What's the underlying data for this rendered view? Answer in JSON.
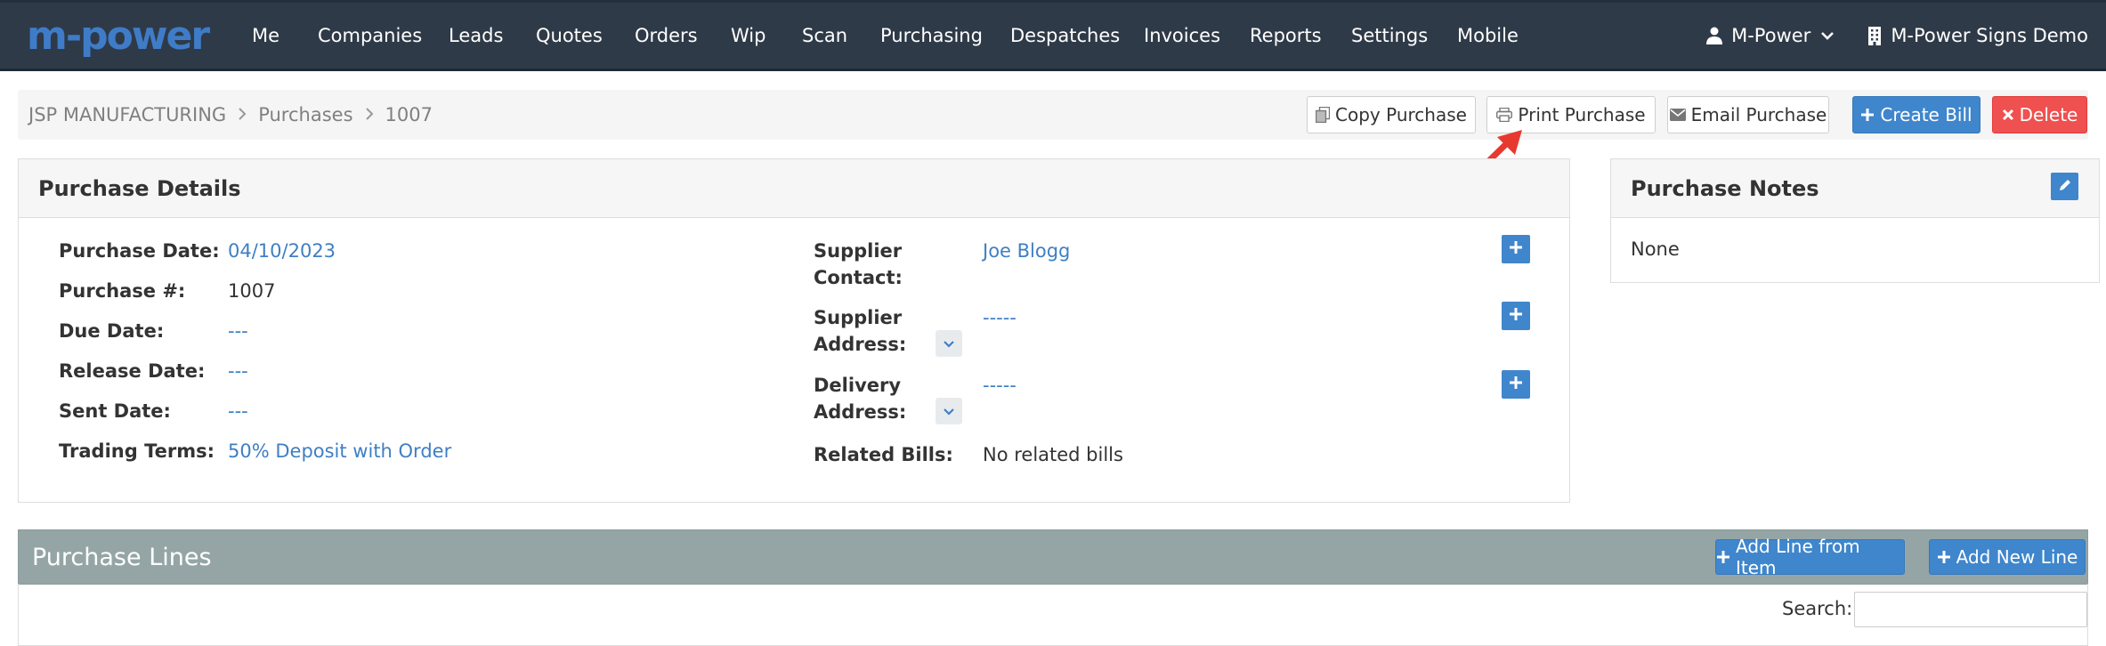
{
  "nav": {
    "logo": "m-power",
    "items": [
      "Me",
      "Companies",
      "Leads",
      "Quotes",
      "Orders",
      "Wip",
      "Scan",
      "Purchasing",
      "Despatches",
      "Invoices",
      "Reports",
      "Settings",
      "Mobile"
    ],
    "user": "M-Power",
    "company": "M-Power Signs Demo"
  },
  "breadcrumb": {
    "items": [
      "JSP MANUFACTURING",
      "Purchases",
      "1007"
    ]
  },
  "toolbar": {
    "copy": "Copy Purchase",
    "print": "Print Purchase",
    "email": "Email Purchase",
    "create_bill": "Create Bill",
    "delete": "Delete"
  },
  "details": {
    "title": "Purchase Details",
    "purchase_date_label": "Purchase Date:",
    "purchase_date": "04/10/2023",
    "purchase_no_label": "Purchase #:",
    "purchase_no": "1007",
    "due_date_label": "Due Date:",
    "due_date": "---",
    "release_date_label": "Release Date:",
    "release_date": "---",
    "sent_date_label": "Sent Date:",
    "sent_date": "---",
    "trading_terms_label": "Trading Terms:",
    "trading_terms": "50% Deposit with Order",
    "supplier_contact_label_1": "Supplier",
    "supplier_contact_label_2": "Contact:",
    "supplier_contact": "Joe Blogg",
    "supplier_address_label_1": "Supplier",
    "supplier_address_label_2": "Address:",
    "supplier_address": "-----",
    "delivery_address_label_1": "Delivery",
    "delivery_address_label_2": "Address:",
    "delivery_address": "-----",
    "related_bills_label": "Related Bills:",
    "related_bills": "No related bills"
  },
  "notes": {
    "title": "Purchase Notes",
    "body": "None"
  },
  "lines": {
    "title": "Purchase Lines",
    "add_from_item": "Add Line from Item",
    "add_new": "Add New Line",
    "search_label": "Search:"
  },
  "colors": {
    "nav_bg": "#2f3a48",
    "primary": "#3f86cc",
    "danger": "#ef5050",
    "link": "#3f7fc4",
    "lines_bar": "#95a5a6",
    "annotation_arrow": "#e8392f"
  }
}
